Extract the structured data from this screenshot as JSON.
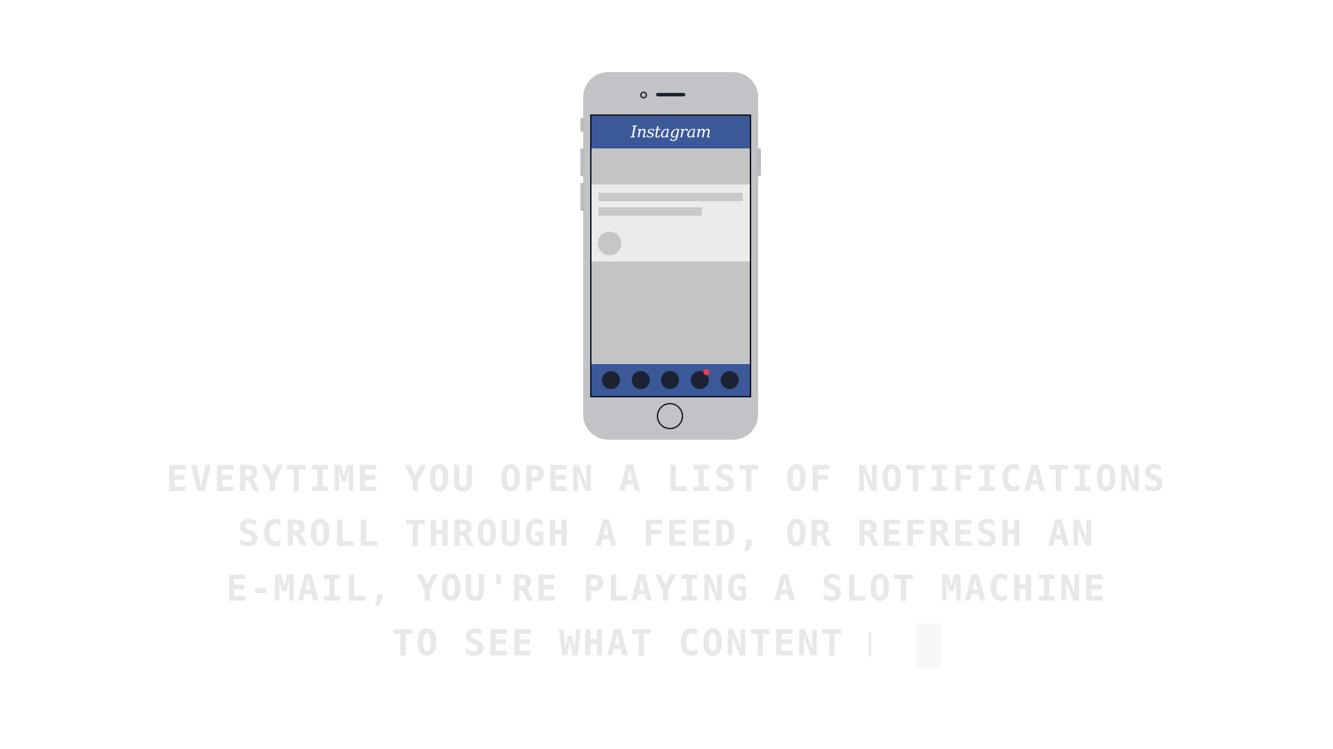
{
  "phone": {
    "app_name": "Instagram",
    "tab_icons": [
      "tab-icon",
      "tab-icon",
      "tab-icon",
      "tab-icon",
      "tab-icon"
    ],
    "notification_color": "#e63f5c",
    "header_color": "#3b5998"
  },
  "caption": {
    "lines": [
      "EVERYTIME YOU OPEN A LIST OF NOTIFICATIONS",
      "SCROLL THROUGH A FEED, OR REFRESH AN",
      "E-MAIL, YOU'RE PLAYING A SLOT MACHINE",
      "TO SEE WHAT CONTENT"
    ]
  }
}
